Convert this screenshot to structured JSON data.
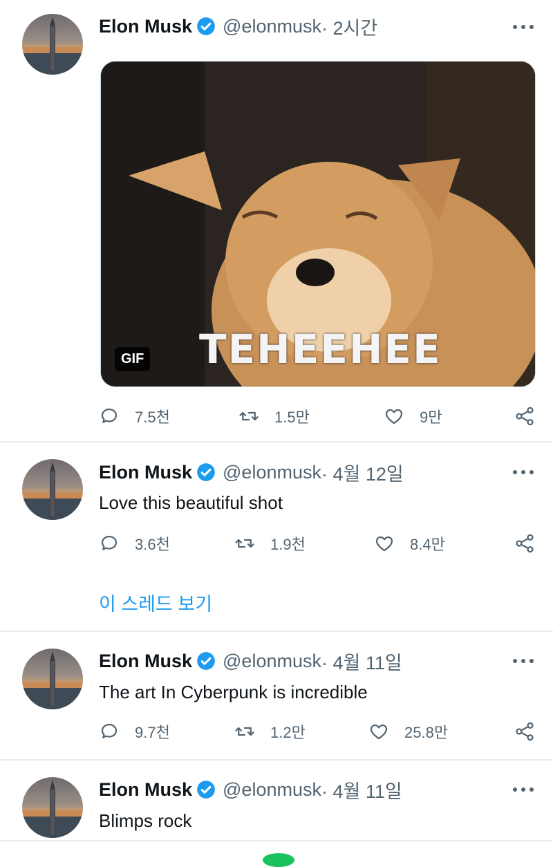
{
  "tweets": [
    {
      "name": "Elon Musk",
      "handle": "@elonmusk",
      "time": " · 2시간",
      "text": "",
      "media": {
        "badge": "GIF",
        "caption": "TEHEEHEE"
      },
      "stats": {
        "replies": "7.5천",
        "retweets": "1.5만",
        "likes": "9만"
      }
    },
    {
      "name": "Elon Musk",
      "handle": "@elonmusk",
      "time": " · 4월 12일",
      "text": "Love this beautiful shot",
      "stats": {
        "replies": "3.6천",
        "retweets": "1.9천",
        "likes": "8.4만"
      }
    },
    {
      "name": "Elon Musk",
      "handle": "@elonmusk",
      "time": " · 4월 11일",
      "text": "The art In Cyberpunk is incredible",
      "stats": {
        "replies": "9.7천",
        "retweets": "1.2만",
        "likes": "25.8만"
      }
    },
    {
      "name": "Elon Musk",
      "handle": "@elonmusk",
      "time": " · 4월 11일",
      "text": "Blimps rock"
    }
  ],
  "thread_link": "이 스레드 보기",
  "colors": {
    "accent": "#1d9bf0",
    "muted": "#536471",
    "divider": "#e6ecf0"
  },
  "icons": [
    "verified-badge-icon",
    "more-options-icon",
    "reply-icon",
    "retweet-icon",
    "like-icon",
    "share-icon"
  ]
}
